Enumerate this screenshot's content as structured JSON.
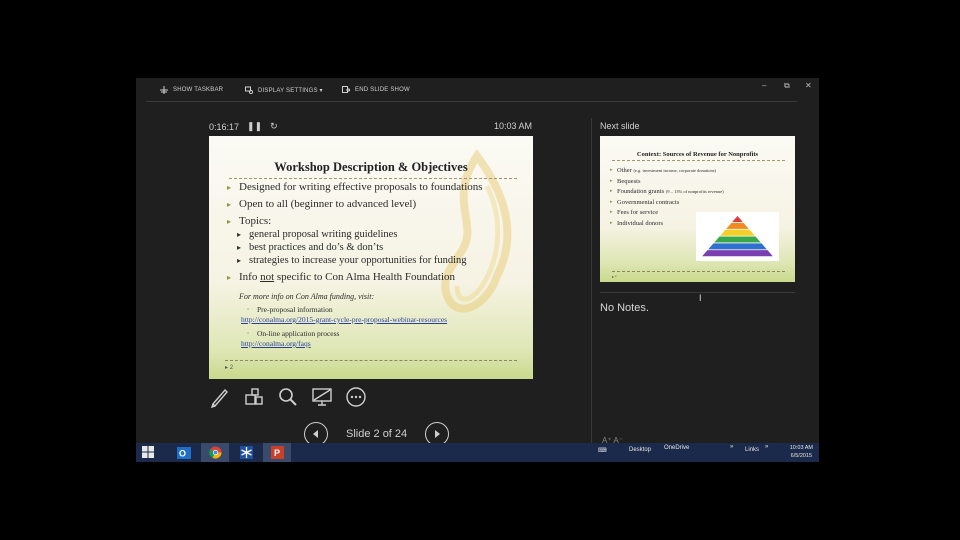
{
  "toolbar": {
    "show_taskbar": "SHOW TASKBAR",
    "display_settings": "DISPLAY SETTINGS ▾",
    "end_slide_show": "END SLIDE SHOW"
  },
  "window_controls": {
    "minimize": "–",
    "restore": "⧉",
    "close": "✕"
  },
  "presenter": {
    "elapsed": "0:16:17",
    "pause_icon": "pause-icon",
    "restart_icon": "restart-icon",
    "clock": "10:03 AM"
  },
  "current_slide": {
    "title": "Workshop Description & Objectives",
    "bullets": {
      "b1": "Designed for writing effective proposals to foundations",
      "b2": "Open to all (beginner to advanced level)",
      "b3": "Topics:",
      "sub1": "general proposal writing guidelines",
      "sub2": "best practices and do’s & don’ts",
      "sub3": "strategies to increase your opportunities for funding",
      "b4_pre": "Info ",
      "b4_not": "not",
      "b4_post": " specific to Con Alma Health Foundation"
    },
    "more_info": "For more info on Con Alma funding, visit:",
    "link1_label": "Pre-proposal information",
    "link1_url": "http://conalma.org/2015-grant-cycle-pre-proposal-webinar-resources",
    "link2_label": "On-line application process",
    "link2_url": "http://conalma.org/faqs",
    "slide_number": "2"
  },
  "slide_navigation": {
    "label": "Slide 2 of 24"
  },
  "next_slide": {
    "header": "Next slide",
    "title": "Context: Sources of Revenue for Nonprofits",
    "item1": "Other",
    "item1_note": "(e.g. investment income, corporate donations)",
    "item2": "Bequests",
    "item3": "Foundation grants",
    "item3_note": "(9 – 13% of nonprofits revenue)",
    "item4": "Governmental contracts",
    "item5": "Fees for service",
    "item6": "Individual donors",
    "pyramid_colors": [
      "#e23b3b",
      "#f28a22",
      "#f4cf2a",
      "#3aa84a",
      "#2f6fd0",
      "#7a3fb0"
    ]
  },
  "notes": {
    "text": "No Notes."
  },
  "taskbar": {
    "desktop": "Desktop",
    "onedrive": "OneDrive",
    "links": "Links",
    "time": "10:03 AM",
    "date": "6/5/2015"
  }
}
